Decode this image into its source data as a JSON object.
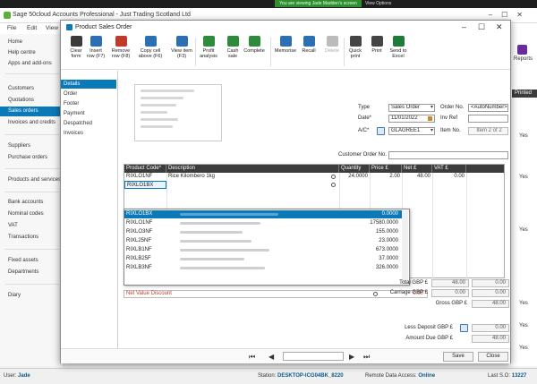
{
  "share_bar": {
    "viewing": "You are viewing Jade Madden's screen",
    "view_options": "View Options"
  },
  "app": {
    "title": "Sage 50cloud Accounts Professional - Just Trading Scotland Ltd",
    "menu": [
      "File",
      "Edit",
      "View"
    ],
    "sidebar": [
      "Home",
      "Help centre",
      "Apps and add-ons",
      "Customers",
      "Quotations",
      "Sales orders",
      "Invoices and credits",
      "Suppliers",
      "Purchase orders",
      "Products and services",
      "Bank accounts",
      "Nominal codes",
      "VAT",
      "Transactions",
      "Fixed assets",
      "Departments",
      "Diary"
    ],
    "active_sidebar": "Sales orders",
    "reports_label": "Reports",
    "printed_header": "Printed",
    "yes_values": [
      "Yes",
      "Yes",
      "Yes",
      "Yes",
      "Yes",
      "Yes"
    ],
    "status": {
      "user_label": "User:",
      "user": "Jade",
      "station_label": "Station:",
      "station": "DESKTOP-ICG04BK_8220",
      "remote_label": "Remote Data Access:",
      "remote": "Online",
      "last_so_label": "Last S.O:",
      "last_so": "13227"
    }
  },
  "dialog": {
    "title": "Product Sales Order",
    "toolbar": [
      {
        "label": "Clear\nform",
        "icon": "clear-form-icon",
        "color": "#3a3a3a"
      },
      {
        "label": "Insert\nrow (F7)",
        "icon": "insert-row-icon",
        "color": "#2c6fb3"
      },
      {
        "label": "Remove\nrow (F8)",
        "icon": "remove-row-icon",
        "color": "#c0392b"
      },
      {
        "label": "Copy cell\nabove (F6)",
        "icon": "copy-cell-icon",
        "color": "#2c6fb3"
      },
      {
        "label": "View item\n(F3)",
        "icon": "view-item-icon",
        "color": "#2c6fb3"
      },
      {
        "label": "Profit\nanalysis",
        "icon": "profit-analysis-icon",
        "color": "#2e8b3c"
      },
      {
        "label": "Cash\nsale",
        "icon": "cash-sale-icon",
        "color": "#2e8b3c"
      },
      {
        "label": "Complete",
        "icon": "complete-icon",
        "color": "#2e8b3c"
      },
      {
        "label": "Memorise",
        "icon": "memorise-icon",
        "color": "#2c6fb3"
      },
      {
        "label": "Recall",
        "icon": "recall-icon",
        "color": "#2c6fb3"
      },
      {
        "label": "Delete",
        "icon": "delete-icon",
        "color": "#bbbbbb"
      },
      {
        "label": "Quick\nprint",
        "icon": "quick-print-icon",
        "color": "#444444"
      },
      {
        "label": "Print",
        "icon": "print-icon",
        "color": "#444444"
      },
      {
        "label": "Send to\nExcel",
        "icon": "excel-icon",
        "color": "#1e7b3a"
      }
    ],
    "nav": [
      "Details",
      "Order",
      "Footer",
      "Payment",
      "Despatched",
      "Invoices"
    ],
    "active_nav": "Details",
    "fields": {
      "type_label": "Type",
      "type_value": "Sales Order",
      "order_no_label": "Order No.",
      "order_no_value": "<AutoNumber>",
      "date_label": "Date*",
      "date_value": "11/01/2022",
      "inv_ref_label": "Inv Ref",
      "ac_label": "A/C*",
      "ac_value": "GLAGREE1",
      "item_no_label": "Item No.",
      "item_no_value": "Item 2 of 2",
      "customer_order_label": "Customer Order No."
    },
    "grid": {
      "headers": [
        "Product Code*",
        "Description",
        "Quantity",
        "Price £",
        "Net £",
        "VAT £"
      ],
      "row1": {
        "code": "RIXLO1NF",
        "desc": "Rice Kilombero 1kg",
        "qty": "24.0000",
        "price": "2.00",
        "net": "48.00",
        "vat": "0.00"
      },
      "row2": {
        "code": "RIXLO1BX"
      }
    },
    "dropdown": [
      {
        "code": "RIXLO1BX",
        "value": "0.0000"
      },
      {
        "code": "RIXLO1NF",
        "value": "17580.0000"
      },
      {
        "code": "RIXLO3NF",
        "value": "155.0000"
      },
      {
        "code": "RIXL25NF",
        "value": "23.0000"
      },
      {
        "code": "RIXLB1NF",
        "value": "673.0000"
      },
      {
        "code": "RIXLB25F",
        "value": "37.0000"
      },
      {
        "code": "RIXLB3NF",
        "value": "326.0000"
      }
    ],
    "net_value_discount": {
      "label": "Net Value Discount",
      "value": "0.00"
    },
    "totals": {
      "total_label": "Total GBP £",
      "total_net": "48.00",
      "total_vat": "0.00",
      "carriage_label": "Carriage GBP £",
      "carriage_net": "0.00",
      "carriage_vat": "0.00",
      "gross_label": "Gross GBP £",
      "gross": "48.00",
      "deposit_label": "Less Deposit GBP £",
      "deposit": "0.00",
      "due_label": "Amount Due GBP £",
      "due": "48.00"
    },
    "buttons": {
      "save": "Save",
      "close": "Close"
    }
  }
}
